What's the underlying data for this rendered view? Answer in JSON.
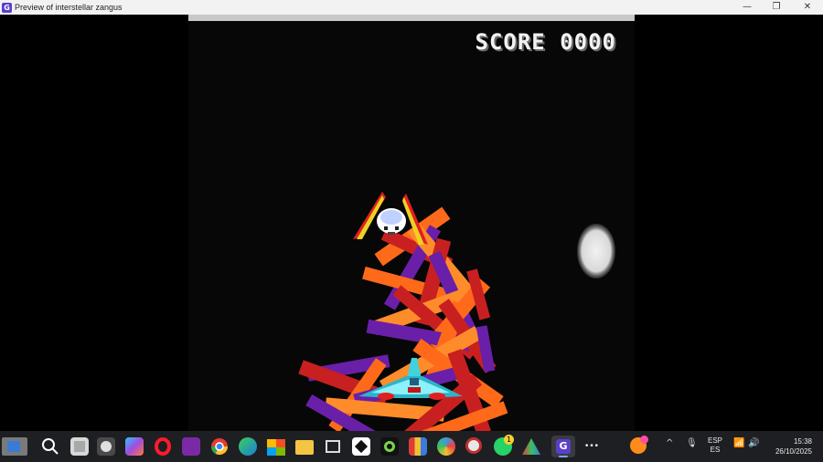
{
  "window": {
    "title": "Preview of interstellar zangus",
    "min_glyph": "—",
    "max_glyph": "❐",
    "close_glyph": "✕"
  },
  "game": {
    "score_label": "SCORE 0000",
    "background_color": "#070707",
    "player_ship_color": "#3fd3e0",
    "enemy_body_color": "#ffffff",
    "enemy_wing_colors": [
      "#e02020",
      "#f0d020"
    ],
    "debris_colors": [
      "#ff6a1a",
      "#c82020",
      "#6a1fa8",
      "#ff8c2a"
    ],
    "moon_color": "#e6e6e6"
  },
  "taskbar": {
    "items": [
      {
        "name": "start-button",
        "icon": "windows-start-icon"
      },
      {
        "name": "search-button",
        "icon": "search-icon"
      },
      {
        "name": "task-view-button",
        "icon": "task-view-icon"
      },
      {
        "name": "copilot-button",
        "icon": "copilot-icon"
      },
      {
        "name": "opera-button",
        "icon": "opera-icon"
      },
      {
        "name": "chrome-button",
        "icon": "chrome-icon"
      },
      {
        "name": "edge-button",
        "icon": "edge-icon"
      },
      {
        "name": "store-button",
        "icon": "store-icon"
      },
      {
        "name": "file-explorer-button",
        "icon": "folder-icon"
      },
      {
        "name": "whatsapp-button",
        "icon": "whatsapp-icon"
      },
      {
        "name": "gdevelop-button",
        "icon": "gdevelop-icon"
      }
    ],
    "whatsapp_badge": "1",
    "language_line1": "ESP",
    "language_line2": "ES",
    "time": "15:38",
    "date": "26/10/2025",
    "overflow_glyph": "•••",
    "tray_chevron": "^"
  }
}
